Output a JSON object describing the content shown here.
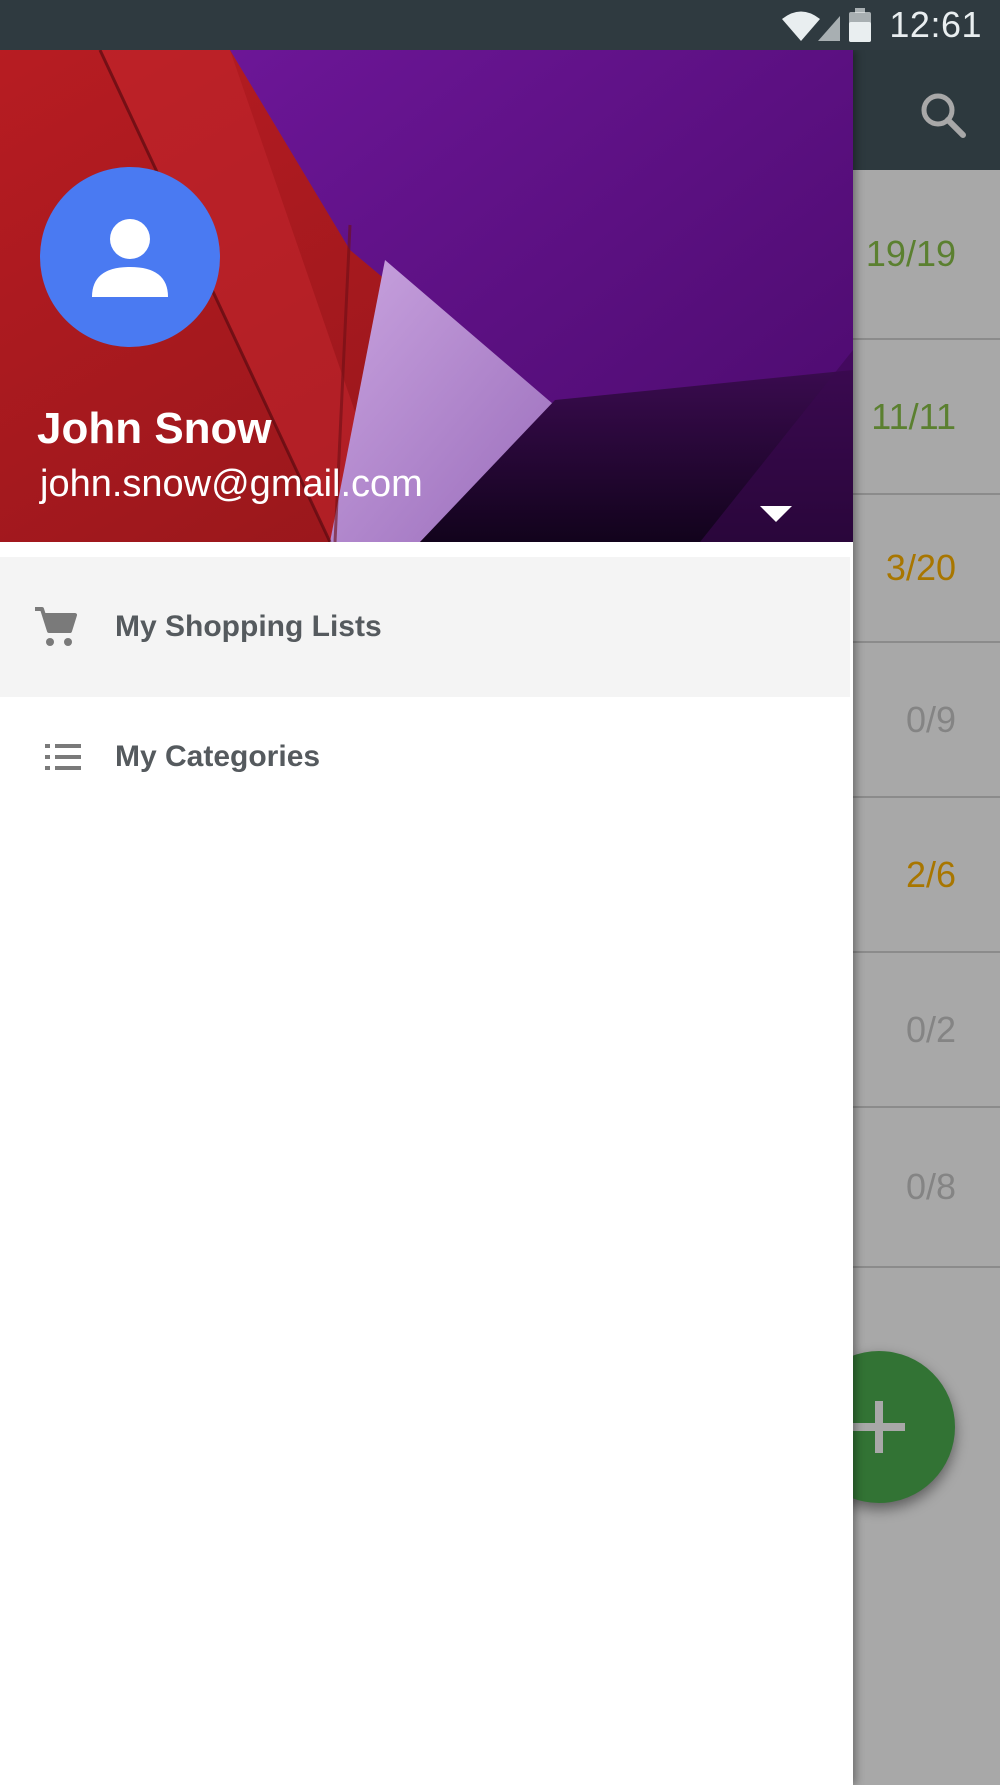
{
  "status_bar": {
    "time": "12:61",
    "icons": [
      "wifi-icon",
      "signal-icon",
      "battery-icon"
    ]
  },
  "toolbar": {
    "search_icon": "search-icon"
  },
  "list": {
    "rows": [
      {
        "count": "19/19",
        "color": "#8bc34a"
      },
      {
        "count": "11/11",
        "color": "#8bc34a"
      },
      {
        "count": "3/20",
        "color": "#ffb300"
      },
      {
        "count": "0/9",
        "color": "#c9c9c9"
      },
      {
        "count": "2/6",
        "color": "#ffb300"
      },
      {
        "count": "0/2",
        "color": "#c9c9c9"
      },
      {
        "count": "0/8",
        "color": "#c9c9c9"
      }
    ],
    "fab_icon": "plus-icon"
  },
  "drawer": {
    "account": {
      "name": "John Snow",
      "email": "john.snow@gmail.com",
      "avatar_color": "#4a7af2",
      "dropdown_icon": "triangle-down-icon"
    },
    "menu": [
      {
        "label": "My Shopping Lists",
        "icon": "cart-icon",
        "selected": true
      },
      {
        "label": "My Categories",
        "icon": "list-icon",
        "selected": false
      }
    ]
  },
  "colors": {
    "status_bar": "#2f3a40",
    "toolbar": "#45575f",
    "fab": "#4caf50"
  }
}
